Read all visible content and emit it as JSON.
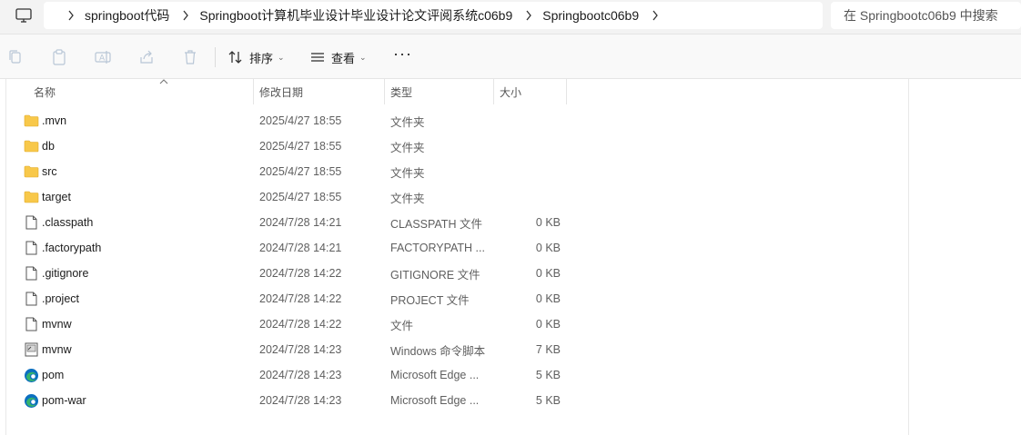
{
  "address_bar": {
    "breadcrumbs": [
      "springboot代码",
      "Springboot计算机毕业设计毕业设计论文评阅系统c06b9",
      "Springbootc06b9"
    ],
    "nav_icon": "monitor-icon",
    "search_placeholder": "在 Springbootc06b9 中搜索"
  },
  "toolbar": {
    "actions": [
      "copy-icon",
      "paste-icon",
      "rename-icon",
      "share-icon",
      "delete-icon"
    ],
    "sort_label": "排序",
    "view_label": "查看",
    "more_label": "···"
  },
  "columns": {
    "name": "名称",
    "date": "修改日期",
    "type": "类型",
    "size": "大小"
  },
  "files": [
    {
      "name": ".mvn",
      "date": "2025/4/27 18:55",
      "type": "文件夹",
      "size": "",
      "icon": "folder-icon"
    },
    {
      "name": "db",
      "date": "2025/4/27 18:55",
      "type": "文件夹",
      "size": "",
      "icon": "folder-icon"
    },
    {
      "name": "src",
      "date": "2025/4/27 18:55",
      "type": "文件夹",
      "size": "",
      "icon": "folder-icon"
    },
    {
      "name": "target",
      "date": "2025/4/27 18:55",
      "type": "文件夹",
      "size": "",
      "icon": "folder-icon"
    },
    {
      "name": ".classpath",
      "date": "2024/7/28 14:21",
      "type": "CLASSPATH 文件",
      "size": "0 KB",
      "icon": "file-icon"
    },
    {
      "name": ".factorypath",
      "date": "2024/7/28 14:21",
      "type": "FACTORYPATH ...",
      "size": "0 KB",
      "icon": "file-icon"
    },
    {
      "name": ".gitignore",
      "date": "2024/7/28 14:22",
      "type": "GITIGNORE 文件",
      "size": "0 KB",
      "icon": "file-icon"
    },
    {
      "name": ".project",
      "date": "2024/7/28 14:22",
      "type": "PROJECT 文件",
      "size": "0 KB",
      "icon": "file-icon"
    },
    {
      "name": "mvnw",
      "date": "2024/7/28 14:22",
      "type": "文件",
      "size": "0 KB",
      "icon": "file-icon"
    },
    {
      "name": "mvnw",
      "date": "2024/7/28 14:23",
      "type": "Windows 命令脚本",
      "size": "7 KB",
      "icon": "script-icon"
    },
    {
      "name": "pom",
      "date": "2024/7/28 14:23",
      "type": "Microsoft Edge ...",
      "size": "5 KB",
      "icon": "edge-icon"
    },
    {
      "name": "pom-war",
      "date": "2024/7/28 14:23",
      "type": "Microsoft Edge ...",
      "size": "5 KB",
      "icon": "edge-icon"
    }
  ],
  "colors": {
    "folder": "#f8c84a",
    "edge_blue": "#0c6fc0",
    "edge_green": "#36b36b"
  }
}
